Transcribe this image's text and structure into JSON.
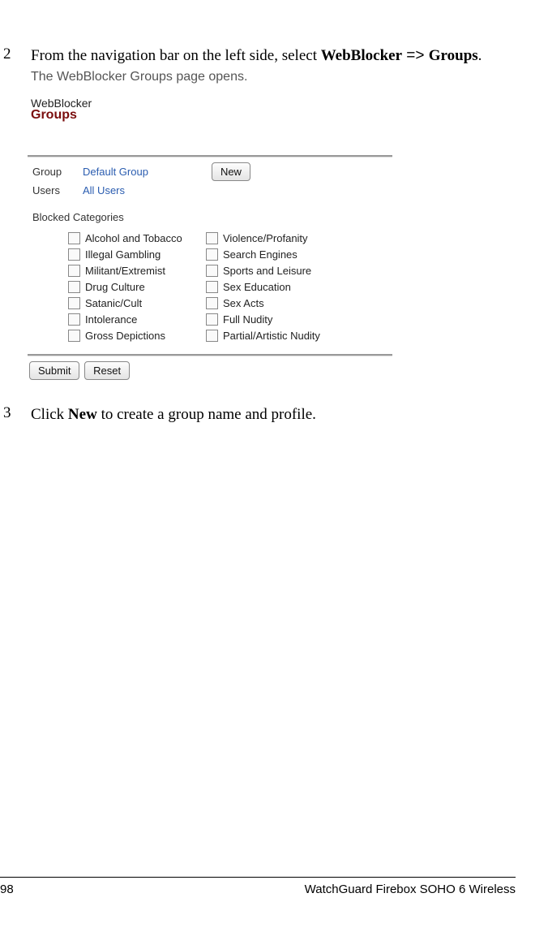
{
  "steps": {
    "s2": {
      "num": "2",
      "text_pre": "From the navigation bar on the left side, select ",
      "bold1": "WebBlocker",
      "arrow": " => ",
      "bold2": "Groups",
      "period": ".",
      "result": "The WebBlocker Groups page opens."
    },
    "s3": {
      "num": "3",
      "text_pre": "Click ",
      "bold1": "New",
      "text_post": " to create a group name and profile."
    }
  },
  "screenshot": {
    "title1": "WebBlocker",
    "title2": "Groups",
    "group_label": "Group",
    "group_value": "Default Group",
    "new_btn": "New",
    "users_label": "Users",
    "users_value": "All Users",
    "section": "Blocked Categories",
    "col1": [
      "Alcohol and Tobacco",
      "Illegal Gambling",
      "Militant/Extremist",
      "Drug Culture",
      "Satanic/Cult",
      "Intolerance",
      "Gross Depictions"
    ],
    "col2": [
      "Violence/Profanity",
      "Search Engines",
      "Sports and Leisure",
      "Sex Education",
      "Sex Acts",
      "Full Nudity",
      "Partial/Artistic Nudity"
    ],
    "submit": "Submit",
    "reset": "Reset"
  },
  "footer": {
    "page": "98",
    "title": "WatchGuard Firebox SOHO 6 Wireless"
  }
}
